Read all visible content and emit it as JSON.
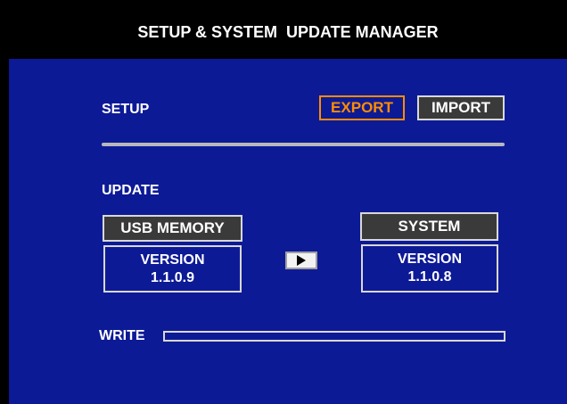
{
  "window": {
    "title": "SETUP & SYSTEM  UPDATE MANAGER"
  },
  "setup": {
    "label": "SETUP",
    "export_label": "EXPORT",
    "import_label": "IMPORT"
  },
  "update": {
    "label": "UPDATE",
    "source": {
      "label": "USB MEMORY",
      "version_label": "VERSION",
      "version": "1.1.0.9"
    },
    "target": {
      "label": "SYSTEM",
      "version_label": "VERSION",
      "version": "1.1.0.8"
    },
    "play_icon": "play-icon"
  },
  "write": {
    "label": "WRITE",
    "progress": 0
  },
  "colors": {
    "panel_bg": "#0d1a96",
    "title_bg": "#000000",
    "accent": "#ff8c00",
    "button_bg": "#3a3a3a",
    "border": "#d8d8d8"
  }
}
